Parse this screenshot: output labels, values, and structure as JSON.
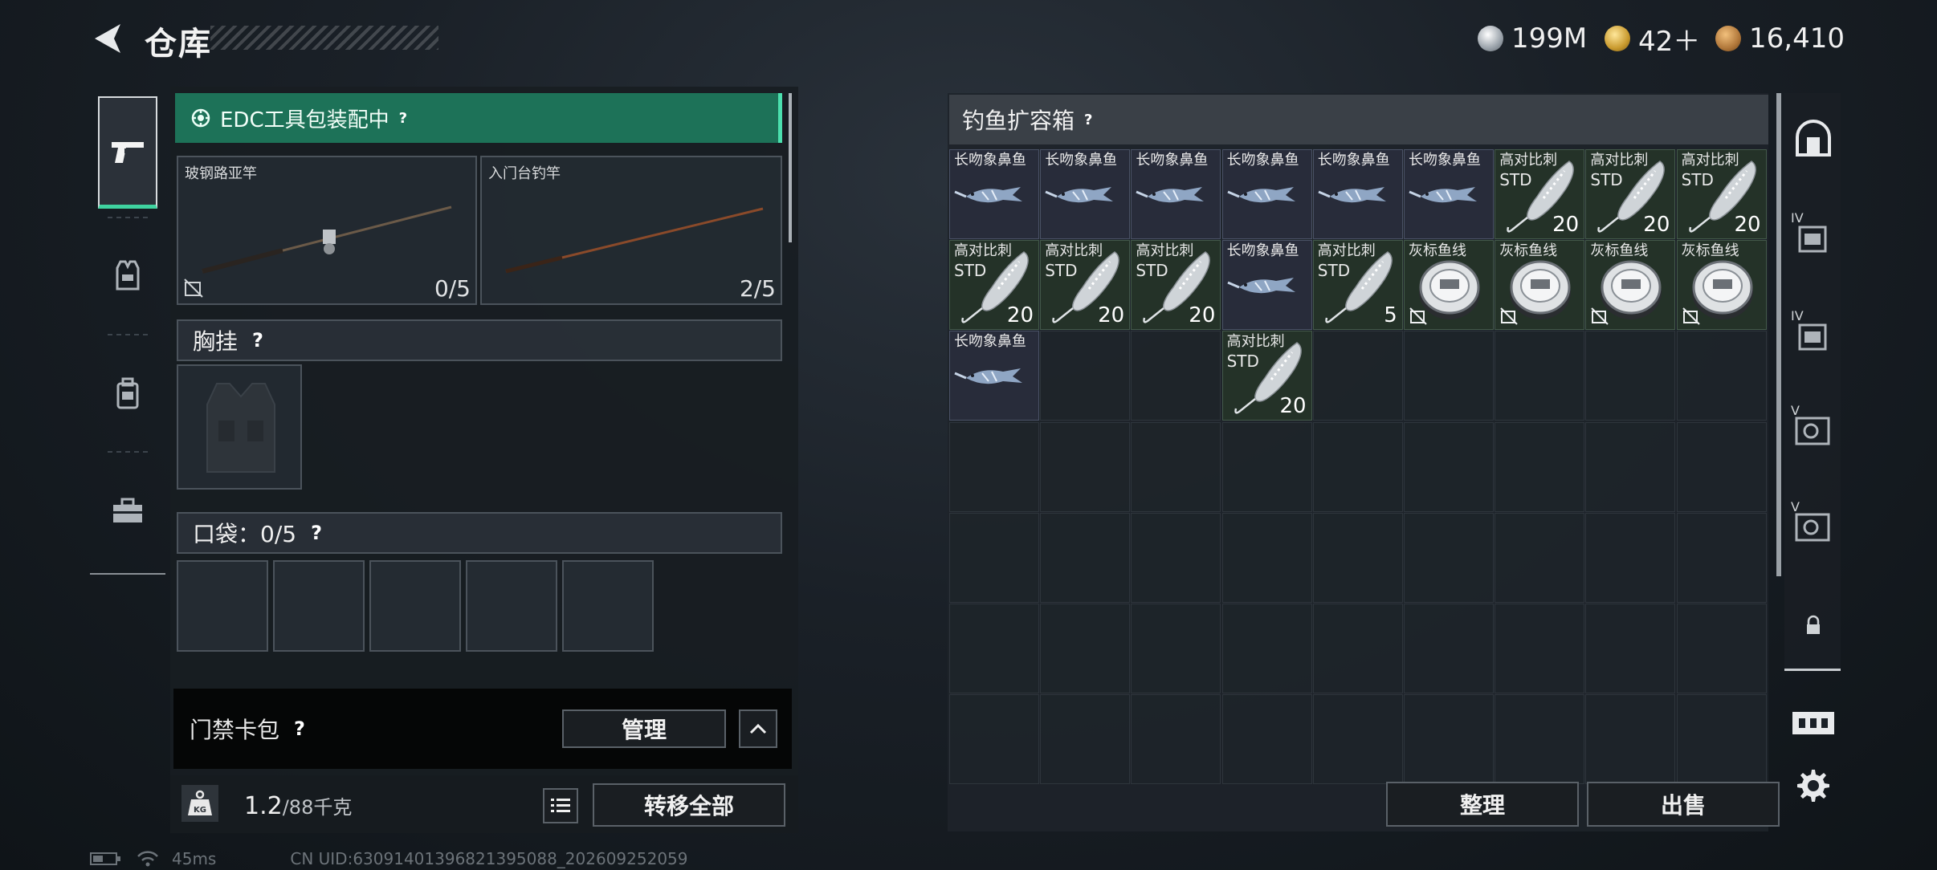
{
  "header": {
    "title": "仓库",
    "currencies": [
      {
        "icon": "silver-coin-icon",
        "value": "199M"
      },
      {
        "icon": "gold-triangle-coin-icon",
        "value": "42＋"
      },
      {
        "icon": "bronze-coin-icon",
        "value": "16,410"
      }
    ]
  },
  "equipment": {
    "edc_status": "EDC工具包装配中",
    "rods": [
      {
        "name": "玻钢路亚竿",
        "count": "0/5"
      },
      {
        "name": "入门台钓竿",
        "count": "2/5"
      }
    ],
    "chest_rig_label": "胸挂",
    "pocket_label": "口袋：0/5",
    "access_card_label": "门禁卡包",
    "manage_label": "管理",
    "weight_current": "1.2",
    "weight_capacity": "/88千克",
    "weight_icon_text": "KG",
    "transfer_all_label": "转移全部"
  },
  "container": {
    "title": "钓鱼扩容箱",
    "items": [
      {
        "type": "fish",
        "name": "长吻象鼻鱼",
        "sub": "",
        "qty": ""
      },
      {
        "type": "fish",
        "name": "长吻象鼻鱼",
        "sub": "",
        "qty": ""
      },
      {
        "type": "fish",
        "name": "长吻象鼻鱼",
        "sub": "",
        "qty": ""
      },
      {
        "type": "fish",
        "name": "长吻象鼻鱼",
        "sub": "",
        "qty": ""
      },
      {
        "type": "fish",
        "name": "长吻象鼻鱼",
        "sub": "",
        "qty": ""
      },
      {
        "type": "fish",
        "name": "长吻象鼻鱼",
        "sub": "",
        "qty": ""
      },
      {
        "type": "lure",
        "name": "高对比刺",
        "sub": "STD",
        "qty": "20"
      },
      {
        "type": "lure",
        "name": "高对比刺",
        "sub": "STD",
        "qty": "20"
      },
      {
        "type": "lure",
        "name": "高对比刺",
        "sub": "STD",
        "qty": "20"
      },
      {
        "type": "lure",
        "name": "高对比刺",
        "sub": "STD",
        "qty": "20"
      },
      {
        "type": "lure",
        "name": "高对比刺",
        "sub": "STD",
        "qty": "20"
      },
      {
        "type": "lure",
        "name": "高对比刺",
        "sub": "STD",
        "qty": "20"
      },
      {
        "type": "fish",
        "name": "长吻象鼻鱼",
        "sub": "",
        "qty": ""
      },
      {
        "type": "lure",
        "name": "高对比刺",
        "sub": "STD",
        "qty": "5"
      },
      {
        "type": "line",
        "name": "灰标鱼线",
        "sub": "",
        "qty": ""
      },
      {
        "type": "line",
        "name": "灰标鱼线",
        "sub": "",
        "qty": ""
      },
      {
        "type": "line",
        "name": "灰标鱼线",
        "sub": "",
        "qty": ""
      },
      {
        "type": "line",
        "name": "灰标鱼线",
        "sub": "",
        "qty": ""
      },
      {
        "type": "fish",
        "name": "长吻象鼻鱼",
        "sub": "",
        "qty": ""
      },
      {
        "type": "empty",
        "name": "",
        "sub": "",
        "qty": ""
      },
      {
        "type": "empty",
        "name": "",
        "sub": "",
        "qty": ""
      },
      {
        "type": "lure",
        "name": "高对比刺",
        "sub": "STD",
        "qty": "20"
      }
    ],
    "sort_label": "整理",
    "sell_label": "出售"
  },
  "right_rail": {
    "tiers": [
      "IV",
      "IV",
      "V",
      "V"
    ]
  },
  "status": {
    "ping": "45ms",
    "uid": "CN UID:63091401396821395088_202609252059"
  },
  "colors": {
    "accent_green": "#4be0ae",
    "banner_green": "#1d7258",
    "fish_cell": "#282c3a",
    "lure_cell": "#243228"
  }
}
